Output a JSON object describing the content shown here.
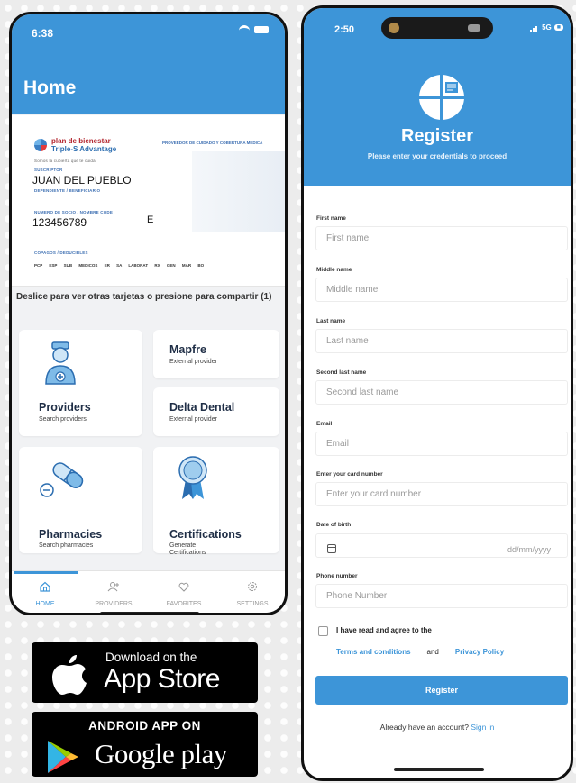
{
  "home_screen": {
    "status_time": "6:38",
    "title": "Home",
    "card": {
      "brand_line1": "plan de bienestar",
      "brand_line2": "Triple-S Advantage",
      "brand_tagline": "Somos la cubierta que te cuida",
      "right_header": "PROVEEDOR DE CUIDADO Y COBERTURA MEDICA",
      "name_label": "SUSCRIPTOR",
      "name": "JUAN DEL PUEBLO",
      "dependent_label": "DEPENDIENTE / BENEFICIARIO",
      "id_label": "NUMERO DE SOCIO / NOMBRE CODE",
      "id": "123456789",
      "suffix": "E",
      "copay_label": "COPAGOS / DEDUCIBLES",
      "copay_row": "PCP  ESP  SUB  MEDICOS  ER  SA  LABORAT  RX  GEN  MAR  BO"
    },
    "swipe_hint": "Deslice para ver otras tarjetas o presione para compartir (1)",
    "tiles": [
      {
        "title": "Providers",
        "subtitle": "Search providers"
      },
      {
        "title": "Mapfre",
        "subtitle": "External provider"
      },
      {
        "title": "Delta Dental",
        "subtitle": "External provider"
      },
      {
        "title": "Pharmacies",
        "subtitle": "Search pharmacies"
      },
      {
        "title": "Certifications",
        "subtitle": "Generate Certifications"
      }
    ],
    "nav": [
      {
        "label": "HOME",
        "icon": "home-icon",
        "active": true
      },
      {
        "label": "PROVIDERS",
        "icon": "providers-icon",
        "active": false
      },
      {
        "label": "FAVORITES",
        "icon": "heart-icon",
        "active": false
      },
      {
        "label": "SETTINGS",
        "icon": "gear-icon",
        "active": false
      }
    ]
  },
  "register_screen": {
    "status_time": "2:50",
    "network": "5G",
    "title": "Register",
    "subtitle": "Please enter your credentials to proceed",
    "fields": [
      {
        "label": "First name",
        "placeholder": "First name"
      },
      {
        "label": "Middle name",
        "placeholder": "Middle name"
      },
      {
        "label": "Last name",
        "placeholder": "Last name"
      },
      {
        "label": "Second last name",
        "placeholder": "Second last name"
      },
      {
        "label": "Email",
        "placeholder": "Email"
      },
      {
        "label": "Enter your card number",
        "placeholder": "Enter your card number"
      },
      {
        "label": "Date of birth",
        "placeholder": "dd/mm/yyyy"
      },
      {
        "label": "Phone number",
        "placeholder": "Phone Number"
      }
    ],
    "agree_text": "I have read and agree to the",
    "terms_link": "Terms and conditions",
    "and_text": "and",
    "privacy_link": "Privacy Policy",
    "register_button": "Register",
    "already_text": "Already have an account?",
    "sign_in_link": "Sign in"
  },
  "badges": {
    "appstore_small": "Download on the",
    "appstore_big": "App Store",
    "google_small": "ANDROID APP ON",
    "google_big": "Google play"
  },
  "colors": {
    "primary": "#3d95d8",
    "tile_title": "#1f2e46"
  }
}
